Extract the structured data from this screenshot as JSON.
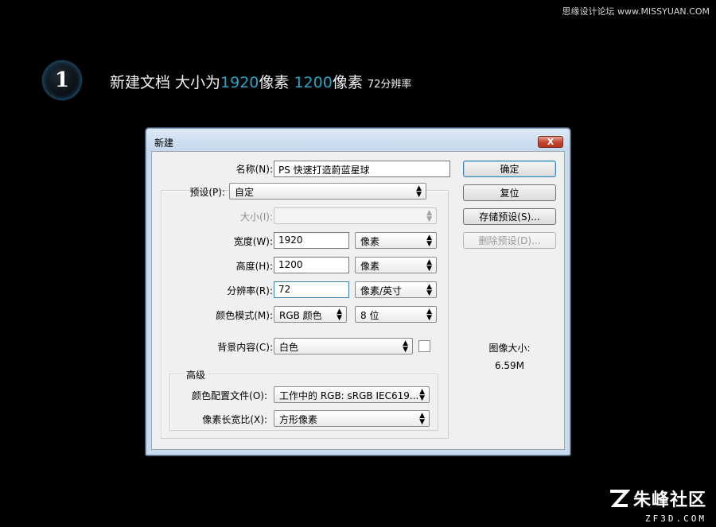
{
  "watermark_top": "思缘设计论坛 www.MISSYUAN.COM",
  "step": "1",
  "headline": {
    "part1": "新建文档 大小为",
    "width": "1920",
    "part2": "像素 ",
    "height": "1200",
    "part3": "像素 ",
    "resolution_note": "72分辨率"
  },
  "dialog": {
    "title": "新建",
    "close_label": "X",
    "fields": {
      "name_label": "名称(N):",
      "name_value": "PS 快速打造蔚蓝星球",
      "preset_label": "预设(P):",
      "preset_value": "自定",
      "size_label": "大小(I):",
      "size_value": "",
      "width_label": "宽度(W):",
      "width_value": "1920",
      "width_unit": "像素",
      "height_label": "高度(H):",
      "height_value": "1200",
      "height_unit": "像素",
      "resolution_label": "分辨率(R):",
      "resolution_value": "72",
      "resolution_unit": "像素/英寸",
      "color_mode_label": "颜色模式(M):",
      "color_mode_value": "RGB 颜色",
      "bit_depth_value": "8 位",
      "background_label": "背景内容(C):",
      "background_value": "白色"
    },
    "advanced": {
      "title": "高级",
      "profile_label": "颜色配置文件(O):",
      "profile_value": "工作中的 RGB: sRGB IEC619...",
      "pixel_aspect_label": "像素长宽比(X):",
      "pixel_aspect_value": "方形像素"
    },
    "buttons": {
      "ok": "确定",
      "reset": "复位",
      "save_preset": "存储预设(S)...",
      "delete_preset": "删除预设(D)..."
    },
    "image_size": {
      "label": "图像大小:",
      "value": "6.59M"
    }
  },
  "logo": {
    "text": "朱峰社区",
    "sub": "ZF3D.COM"
  }
}
